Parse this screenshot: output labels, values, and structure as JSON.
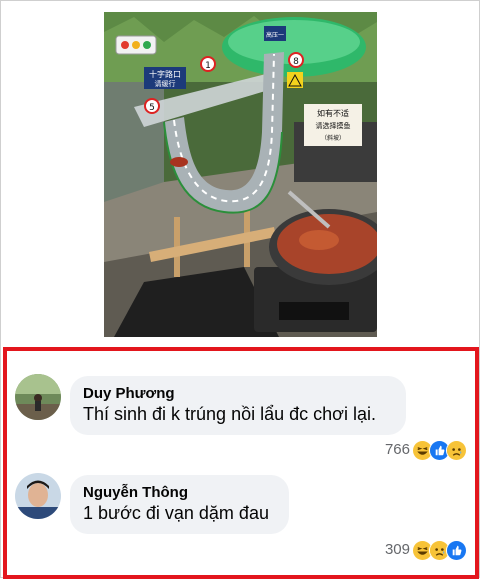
{
  "photo": {
    "sign_top": "高压一",
    "sign_crossroad_line1": "十字路口",
    "sign_crossroad_line2": "请缓行",
    "sign_handwritten_line1": "如有不适",
    "sign_handwritten_line2": "请选择摸鱼",
    "sign_handwritten_line3": "（斜坡）",
    "badge_1": "1",
    "badge_5": "5",
    "badge_8": "8"
  },
  "comments": [
    {
      "author": "Duy Phương",
      "text": "Thí sinh đi k trúng nồi lẩu đc chơi lại.",
      "reaction_count": "766",
      "reactions": [
        "haha",
        "like",
        "sad"
      ]
    },
    {
      "author": "Nguyễn Thông",
      "text": "1 bước đi vạn dặm đau",
      "reaction_count": "309",
      "reactions": [
        "haha",
        "sad",
        "like"
      ]
    }
  ],
  "colors": {
    "highlight_border": "#e3161d",
    "bubble_bg": "#f0f2f5",
    "like_blue": "#1877f2",
    "emoji_yellow": "#f7c338"
  }
}
